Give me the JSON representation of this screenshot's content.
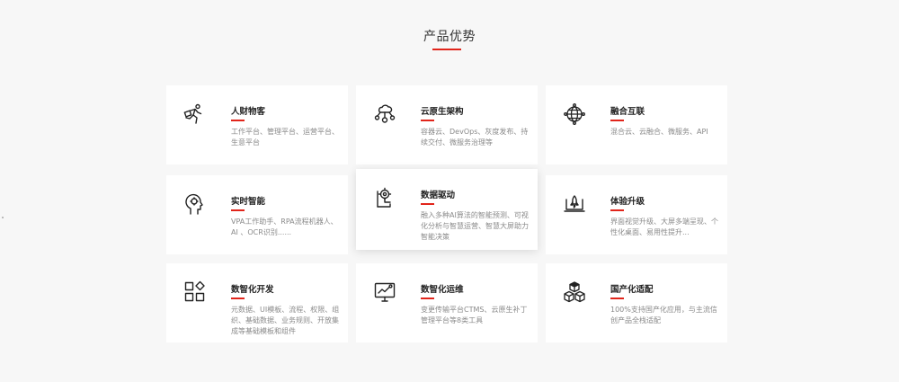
{
  "section": {
    "title": "产品优势"
  },
  "colors": {
    "accent": "#e1251b",
    "background": "#f7f7f7",
    "card": "#ffffff"
  },
  "cards": [
    {
      "icon": "running-person-icon",
      "title": "人财物客",
      "desc": "工作平台、管理平台、运营平台、生意平台"
    },
    {
      "icon": "cloud-network-icon",
      "title": "云原生架构",
      "desc": "容器云、DevOps、灰度发布、持续交付、微服务治理等"
    },
    {
      "icon": "globe-network-icon",
      "title": "融合互联",
      "desc": "混合云、云融合、微服务、API"
    },
    {
      "icon": "head-brain-icon",
      "title": "实时智能",
      "desc": "VPA工作助手、RPA流程机器人、AI 、OCR识别......"
    },
    {
      "icon": "data-drive-icon",
      "title": "数据驱动",
      "desc": "融入多种AI算法的智能预测、可视化分析与智慧运营、智慧大屏助力智能决策"
    },
    {
      "icon": "laptop-rocket-icon",
      "title": "体验升级",
      "desc": "界面视觉升级、大屏多端呈现、个性化桌面、易用性提升..."
    },
    {
      "icon": "grid-blocks-icon",
      "title": "数智化开发",
      "desc": "元数据、UI模板、流程、权限、组织、基础数据、业务规则、开放集成等基础模板和组件"
    },
    {
      "icon": "monitor-chart-icon",
      "title": "数智化运维",
      "desc": "变更传输平台CTMS、云原生补丁管理平台等8类工具"
    },
    {
      "icon": "cubes-icon",
      "title": "国产化适配",
      "desc": "100%支持国产化应用，与主流信创产品全栈适配"
    }
  ]
}
